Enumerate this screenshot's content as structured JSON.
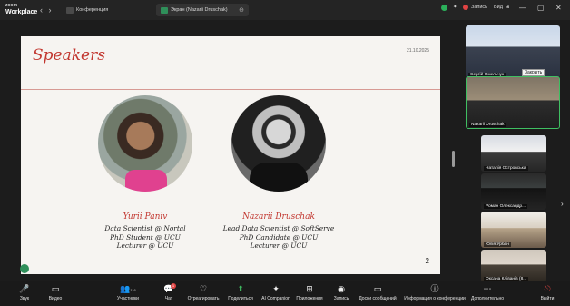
{
  "app": {
    "brand_top": "zoom",
    "brand_bottom": "Workplace",
    "nav_icons": "‹ ›",
    "tab_conference": "Конференция",
    "tab_screen": "Экран (Nazarii Druschak)",
    "record_label": "Запись",
    "view_label": "Вид",
    "win_min": "—",
    "win_max": "▢",
    "win_close": "✕"
  },
  "slide": {
    "title": "Speakers",
    "date": "21.10.2025",
    "page_number": "2",
    "speakers": [
      {
        "name": "Yurii Paniv",
        "roles": [
          "Data Scientist @ Nortal",
          "PhD Student @ UCU",
          "Lecturer @ UCU"
        ]
      },
      {
        "name": "Nazarii Druschak",
        "roles": [
          "Lead Data Scientist @ SoftServe",
          "PhD Candidate @ UCU",
          "Lecturer @ UCU"
        ]
      }
    ]
  },
  "participants": {
    "tiles": [
      {
        "name": "Сергій Омельчук"
      },
      {
        "name": "Nazarii Druschak"
      },
      {
        "name": "Наталія Островська"
      },
      {
        "name": "Роман Олександр..."
      },
      {
        "name": "Юлія Урбан"
      },
      {
        "name": "Оксана Кліванів (8..."
      }
    ],
    "tooltip": "Закрыть"
  },
  "toolbar": {
    "items": [
      {
        "label": "Звук",
        "icon": "🎤"
      },
      {
        "label": "Видео",
        "icon": "▭"
      },
      {
        "label": "Участники",
        "icon": "👥",
        "count": "116"
      },
      {
        "label": "Чат",
        "icon": "💬",
        "badge": "1"
      },
      {
        "label": "Отреагировать",
        "icon": "♡"
      },
      {
        "label": "Поделиться",
        "icon": "⬆"
      },
      {
        "label": "AI Companion",
        "icon": "✦"
      },
      {
        "label": "Приложения",
        "icon": "⊞"
      },
      {
        "label": "Запись",
        "icon": "◉"
      },
      {
        "label": "Доски сообщений",
        "icon": "▭"
      },
      {
        "label": "Информация о конференции",
        "icon": "ⓘ"
      },
      {
        "label": "Дополнительно",
        "icon": "⋯"
      },
      {
        "label": "Выйти",
        "icon": "⎋"
      }
    ]
  },
  "colors": {
    "accent_red": "#c2362f",
    "active_speaker_border": "#3fbf62",
    "toolbar_bg": "#1a1a1a"
  }
}
